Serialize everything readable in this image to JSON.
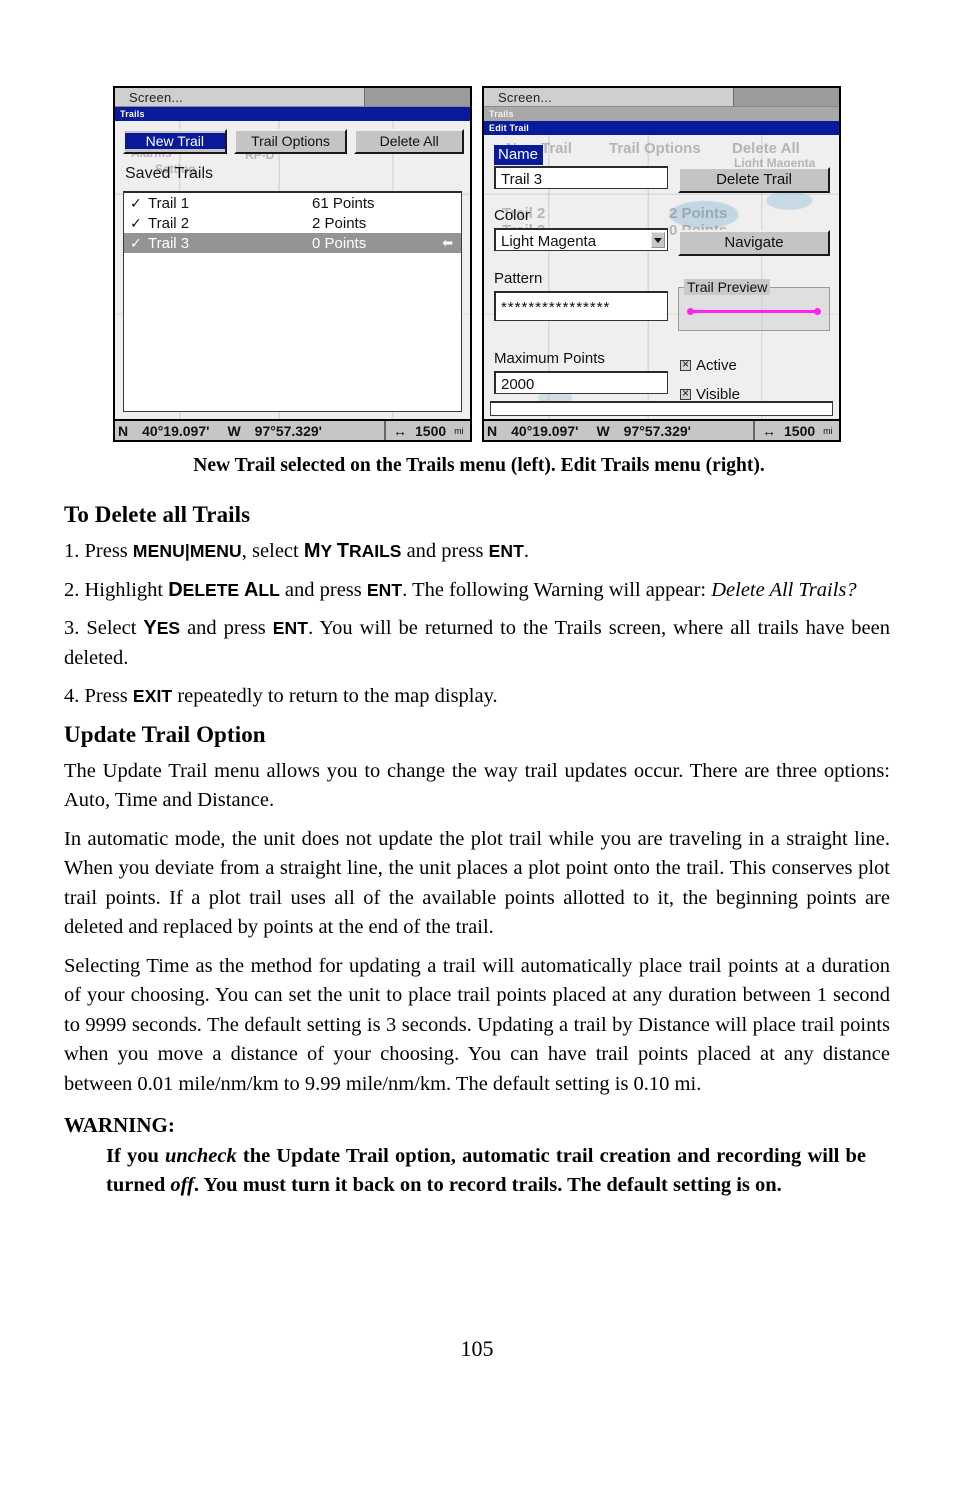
{
  "figure": {
    "left_screen": {
      "top_bar_label": "Screen...",
      "breadcrumb": "Trails",
      "buttons": [
        {
          "label": "New Trail",
          "selected": true
        },
        {
          "label": "Trail Options",
          "selected": false
        },
        {
          "label": "Delete All",
          "selected": false
        }
      ],
      "list_title": "Saved Trails",
      "trails": [
        {
          "checked": "✓",
          "name": "Trail 1",
          "points": "61 Points",
          "highlighted": false,
          "arrow": ""
        },
        {
          "checked": "✓",
          "name": "Trail 2",
          "points": "2 Points",
          "highlighted": false,
          "arrow": ""
        },
        {
          "checked": "✓",
          "name": "Trail 3",
          "points": "0 Points",
          "highlighted": true,
          "arrow": "⬅"
        }
      ],
      "status": {
        "ns": "N",
        "lat": "40°19.097'",
        "ew": "W",
        "lon": "97°57.329'",
        "range_icon": "↔",
        "range": "1500",
        "range_unit": "mi"
      },
      "map_labels": [
        "Alarms",
        "Setting",
        "RP-D"
      ]
    },
    "right_screen": {
      "top_bar_label": "Screen...",
      "breadcrumb": "Trails",
      "dialog_title": "Edit Trail",
      "name_label": "Name",
      "name_value": "Trail 3",
      "color_label": "Color",
      "color_value": "Light Magenta",
      "pattern_label": "Pattern",
      "pattern_value": "****************",
      "max_points_label": "Maximum Points",
      "max_points_value": "2000",
      "delete_trail_button": "Delete Trail",
      "navigate_button": "Navigate",
      "trail_preview_label": "Trail Preview",
      "trail_preview_color": "#ff22ee",
      "checkboxes": [
        {
          "label": "Active",
          "checked": true
        },
        {
          "label": "Visible",
          "checked": true
        }
      ],
      "status": {
        "ns": "N",
        "lat": "40°19.097'",
        "ew": "W",
        "lon": "97°57.329'",
        "range_icon": "↔",
        "range": "1500",
        "range_unit": "mi"
      },
      "map_labels": [
        "New Trail",
        "Trail Options",
        "Delete All",
        "Light Magenta",
        "Trail 2",
        "2 Points",
        "Trail 3",
        "0 Points"
      ]
    },
    "caption": "New Trail selected on the Trails menu (left). Edit Trails menu (right)."
  },
  "content": {
    "heading_delete": "To Delete all Trails",
    "step1": {
      "pre": "1. Press ",
      "k1": "MENU",
      "sep": "|",
      "k2": "MENU",
      "mid": ", select ",
      "sc1_cap": "M",
      "sc1_rest": "Y ",
      "sc2_cap": "T",
      "sc2_rest": "RAILS",
      "mid2": " and press ",
      "k3": "ENT",
      "end": "."
    },
    "step2": {
      "pre": "2. Highlight ",
      "sc1_cap": "D",
      "sc1_rest": "ELETE ",
      "sc2_cap": "A",
      "sc2_rest": "LL",
      "mid": " and press ",
      "k1": "ENT",
      "mid2": ". The following Warning will appear: ",
      "italic": "Delete All Trails?"
    },
    "step3": {
      "pre": "3. Select ",
      "sc1_cap": "Y",
      "sc1_rest": "ES",
      "mid": " and press ",
      "k1": "ENT",
      "end": ". You will be returned to the Trails screen, where all trails have been deleted."
    },
    "step4": {
      "pre": "4. Press ",
      "k1": "EXIT",
      "end": " repeatedly to return to the map display."
    },
    "heading_update": "Update Trail Option",
    "para_update": "The Update Trail menu allows you to change the way trail updates occur. There are three options: Auto, Time and Distance.",
    "para_auto": "In automatic mode, the unit does not update the plot trail while you are traveling in a straight line. When you deviate from a straight line, the unit places a plot point onto the trail. This conserves plot trail points. If a plot trail uses all of the available points allotted to it, the beginning points are deleted and replaced by points at the end of the trail.",
    "para_time": "Selecting Time as the method for updating a trail will automatically place trail points at a duration of your choosing. You can set the unit to place trail points placed at any duration between 1 second to 9999 seconds. The default setting is 3 seconds. Updating a trail by Distance will place trail points when you move a distance of your choosing. You can have trail points placed at any distance between 0.01 mile/nm/km to 9.99 mile/nm/km. The default setting is 0.10 mi.",
    "warning_head": "WARNING:",
    "warning": {
      "p1": "If you ",
      "i1": "uncheck",
      "p2": " the Update Trail option, automatic trail creation and recording will be turned ",
      "i2": "off",
      "p3": ". You must turn it back on to record trails. The default setting is on."
    },
    "page_number": "105"
  }
}
